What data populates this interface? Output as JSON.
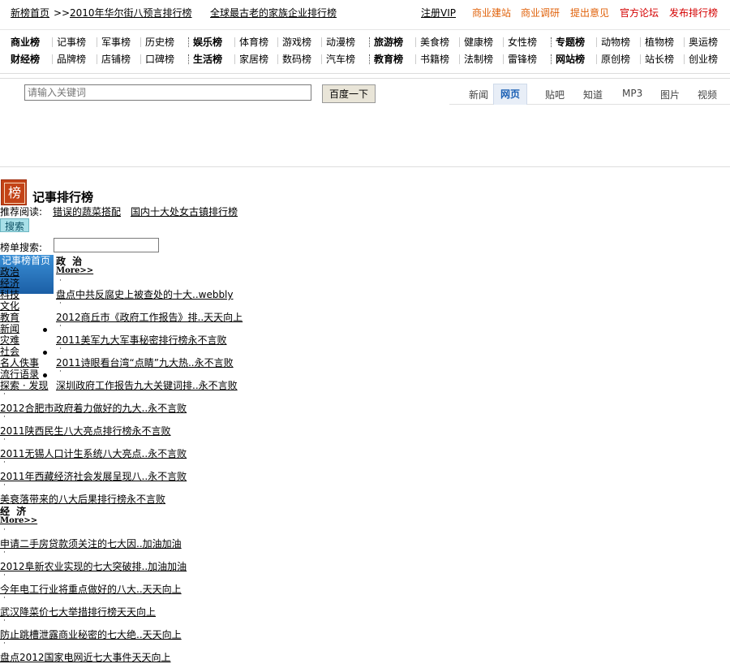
{
  "topbar": {
    "home": "新榜首页",
    "arrow": ">>",
    "headline1": "2010年华尔街八预言排行榜",
    "headline2": "全球最古老的家族企业排行榜",
    "register": "注册VIP",
    "links": [
      {
        "label": "商业建站",
        "color": "#e0620b"
      },
      {
        "label": "商业调研",
        "color": "#e0620b"
      },
      {
        "label": "提出意见",
        "color": "#e0620b"
      },
      {
        "label": "官方论坛",
        "color": "#d40000"
      },
      {
        "label": "发布排行榜",
        "color": "#d40000"
      }
    ]
  },
  "catnav": {
    "row1": [
      {
        "label": "商业榜",
        "bold": true
      },
      {
        "label": "记事榜"
      },
      {
        "label": "军事榜"
      },
      {
        "label": "历史榜"
      },
      {
        "label": "娱乐榜",
        "bold": true
      },
      {
        "label": "体育榜"
      },
      {
        "label": "游戏榜"
      },
      {
        "label": "动漫榜"
      },
      {
        "label": "旅游榜",
        "bold": true
      },
      {
        "label": "美食榜"
      },
      {
        "label": "健康榜"
      },
      {
        "label": "女性榜"
      },
      {
        "label": "专题榜",
        "bold": true
      },
      {
        "label": "动物榜"
      },
      {
        "label": "植物榜"
      },
      {
        "label": "奥运榜"
      }
    ],
    "row2": [
      {
        "label": "财经榜",
        "bold": true
      },
      {
        "label": "品牌榜"
      },
      {
        "label": "店铺榜"
      },
      {
        "label": "口碑榜"
      },
      {
        "label": "生活榜",
        "bold": true
      },
      {
        "label": "家居榜"
      },
      {
        "label": "数码榜"
      },
      {
        "label": "汽车榜"
      },
      {
        "label": "教育榜",
        "bold": true
      },
      {
        "label": "书籍榜"
      },
      {
        "label": "法制榜"
      },
      {
        "label": "雷锋榜"
      },
      {
        "label": "网站榜",
        "bold": true
      },
      {
        "label": "原创榜"
      },
      {
        "label": "站长榜"
      },
      {
        "label": "创业榜"
      }
    ]
  },
  "search": {
    "placeholder": "请输入关键词",
    "button": "百度一下",
    "tabs": [
      "新闻",
      "网页",
      "贴吧",
      "知道",
      "MP3",
      "图片",
      "视频"
    ],
    "active_tab": "网页"
  },
  "page": {
    "logo_char": "榜",
    "title": "记事排行榜",
    "recommend_label": "推荐阅读:",
    "recommend": [
      "错误的蔬菜搭配",
      "国内十大处女古镇排行榜"
    ],
    "search_button": "搜索",
    "list_search_label": "榜单搜索:"
  },
  "sidebar": [
    "记事榜首页",
    "政治",
    "经济",
    "科技",
    "文化",
    "教育",
    "新闻",
    "灾难",
    "社会",
    "名人佚事",
    "流行语录",
    "探索 · 发现"
  ],
  "sections": [
    {
      "title": "政 治",
      "more": "More>>",
      "items": [
        "盘点中共反腐史上被查处的十大..webbly",
        "2012商丘市《政府工作报告》排..天天向上",
        "2011美军九大军事秘密排行榜永不言败",
        "2011诗眼看台湾“点睛”九大热..永不言败",
        "深圳政府工作报告九大关键词排..永不言败",
        "2012合肥市政府着力做好的九大..永不言败",
        "2011陕西民生八大亮点排行榜永不言败",
        "2011无锡人口计生系统八大亮点..永不言败",
        "2011年西藏经济社会发展呈现八..永不言败",
        "美衰落带来的八大后果排行榜永不言败"
      ]
    },
    {
      "title": "经 济",
      "more": "More>>",
      "items": [
        "申请二手房贷款须关注的七大因..加油加油",
        "2012阜新农业实现的七大突破排..加油加油",
        "今年电工行业将重点做好的八大..天天向上",
        "武汉降菜价七大举措排行榜天天向上",
        "防止跳槽泄露商业秘密的七大绝..天天向上",
        "盘点2012国家电网近七大事件天天向上"
      ]
    }
  ]
}
